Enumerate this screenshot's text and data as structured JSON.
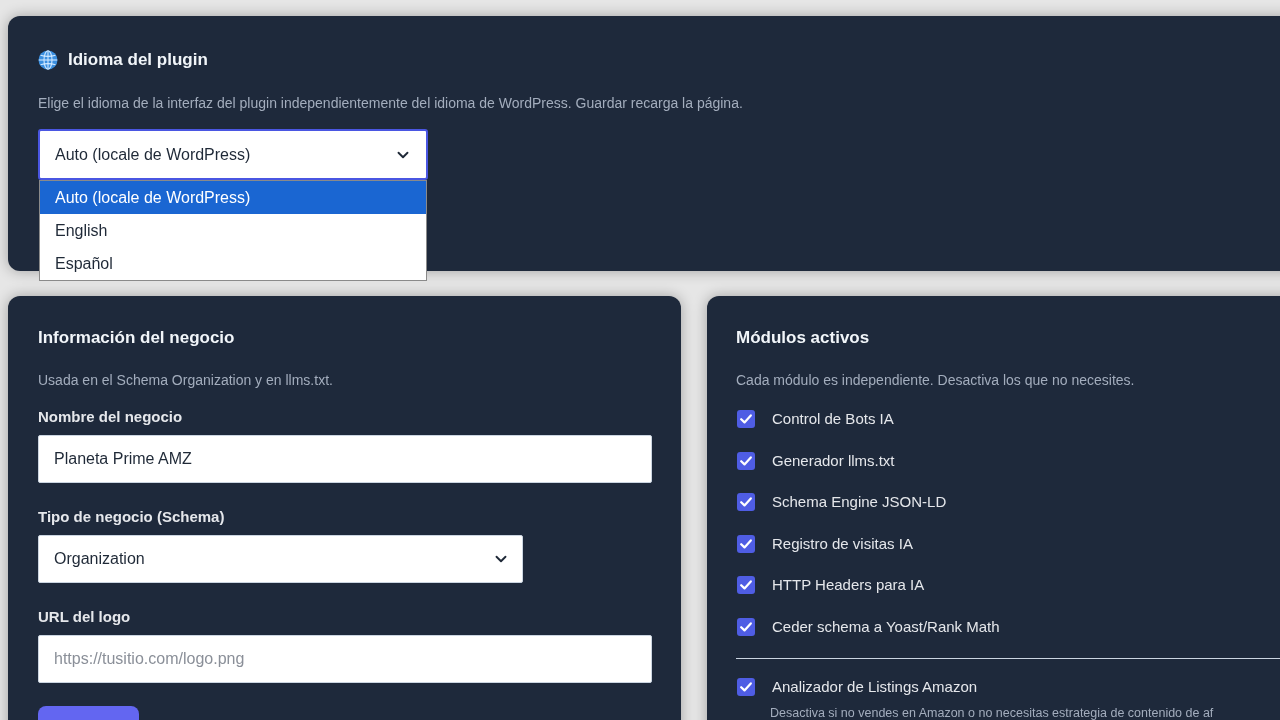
{
  "language_card": {
    "title": "Idioma del plugin",
    "description": "Elige el idioma de la interfaz del plugin independientemente del idioma de WordPress. Guardar recarga la página.",
    "select": {
      "value": "Auto (locale de WordPress)",
      "expanded": true,
      "options": [
        {
          "label": "Auto (locale de WordPress)",
          "selected": true
        },
        {
          "label": "English",
          "selected": false
        },
        {
          "label": "Español",
          "selected": false
        }
      ]
    }
  },
  "business_card": {
    "title": "Información del negocio",
    "description": "Usada en el Schema Organization y en llms.txt.",
    "fields": [
      {
        "kind": "text",
        "label": "Nombre del negocio",
        "value": "Planeta Prime AMZ"
      },
      {
        "kind": "select",
        "label": "Tipo de negocio (Schema)",
        "value": "Organization"
      },
      {
        "kind": "text",
        "label": "URL del logo",
        "placeholder": "https://tusitio.com/logo.png"
      }
    ]
  },
  "modules_card": {
    "title": "Módulos activos",
    "description": "Cada módulo es independiente. Desactiva los que no necesites.",
    "modules": [
      {
        "label": "Control de Bots IA",
        "checked": true
      },
      {
        "label": "Generador llms.txt",
        "checked": true
      },
      {
        "label": "Schema Engine JSON-LD",
        "checked": true
      },
      {
        "label": "Registro de visitas IA",
        "checked": true
      },
      {
        "label": "HTTP Headers para IA",
        "checked": true
      },
      {
        "label": "Ceder schema a Yoast/Rank Math",
        "checked": true
      }
    ],
    "extra_modules": [
      {
        "label": "Analizador de Listings Amazon",
        "checked": true,
        "note": "Desactiva si no vendes en Amazon o no necesitas estrategia de contenido de af"
      }
    ]
  }
}
